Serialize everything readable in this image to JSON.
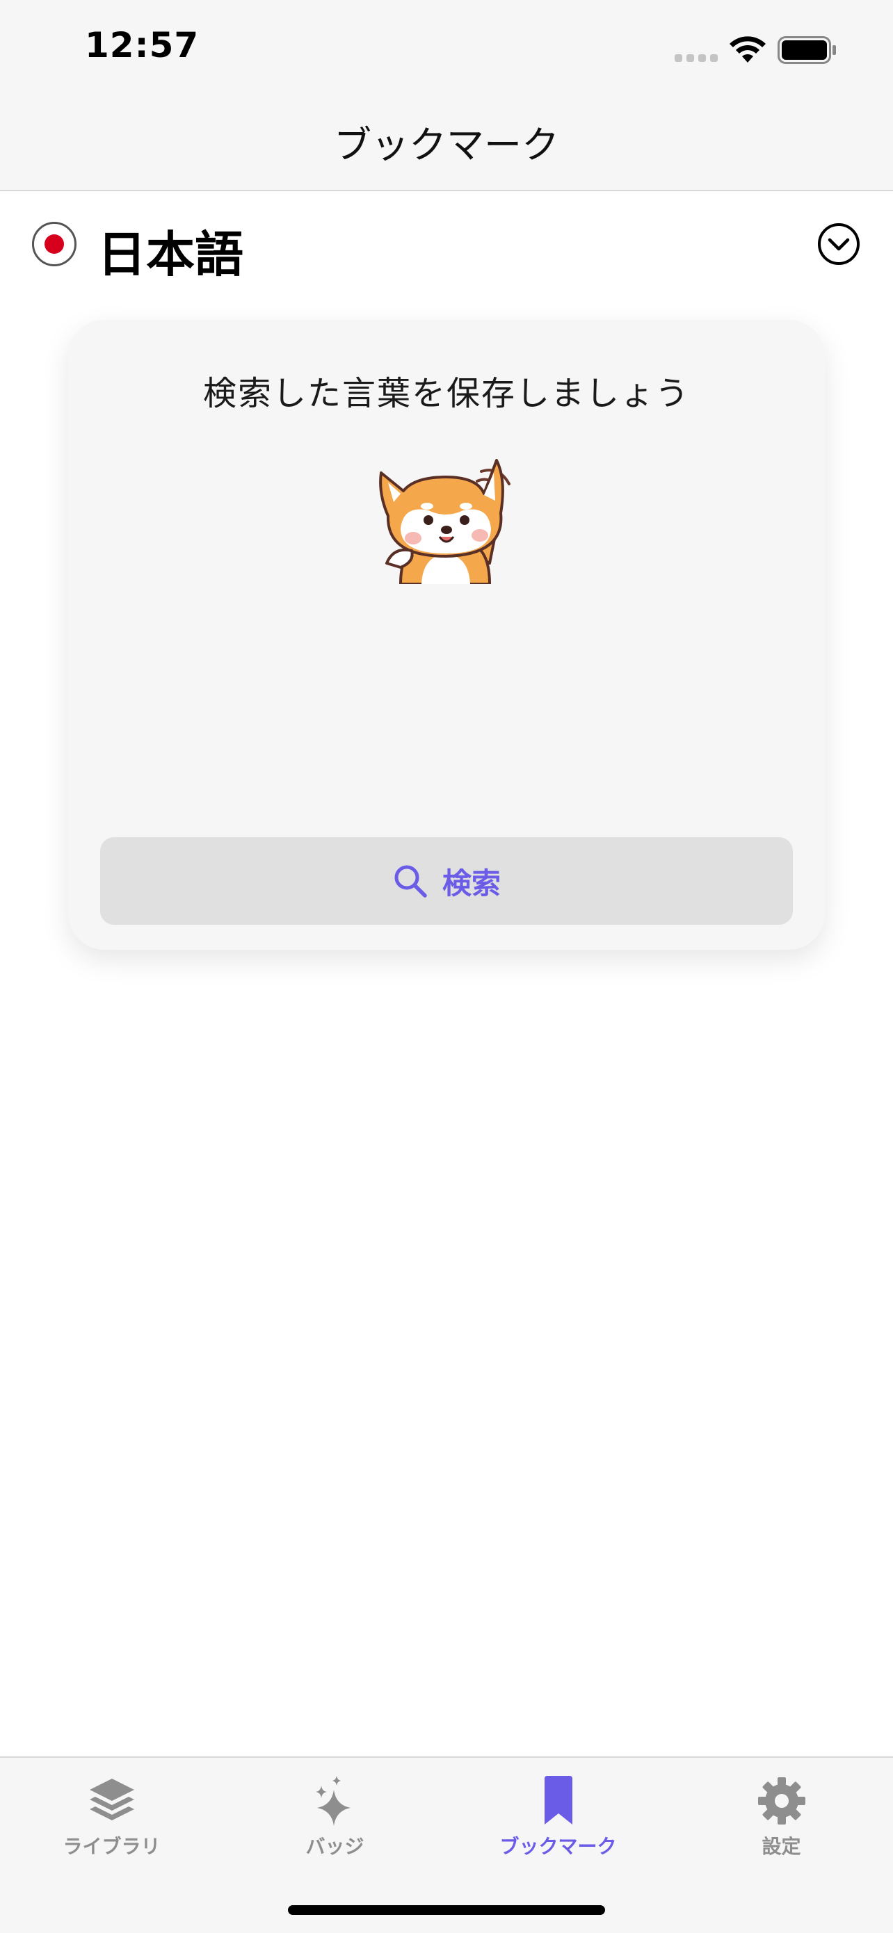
{
  "status_bar": {
    "time": "12:57",
    "icons": [
      "cellular-signal-icon",
      "wifi-icon",
      "battery-icon"
    ]
  },
  "nav_bar": {
    "title": "ブックマーク"
  },
  "language": {
    "name": "日本語",
    "flag_icon": "japan-flag-icon",
    "toggle_icon": "chevron-down-circle-icon"
  },
  "empty_state": {
    "message": "検索した言葉を保存しましょう",
    "illustration": "shiba-dog-waving-illustration",
    "search_button_label": "検索",
    "search_icon": "search-icon"
  },
  "tab_bar": {
    "tabs": [
      {
        "label": "ライブラリ",
        "icon": "stack-layers-icon",
        "active": false
      },
      {
        "label": "バッジ",
        "icon": "sparkles-icon",
        "active": false
      },
      {
        "label": "ブックマーク",
        "icon": "bookmark-icon",
        "active": true
      },
      {
        "label": "設定",
        "icon": "gear-icon",
        "active": false
      }
    ]
  },
  "colors": {
    "accent": "#6b5ce7",
    "inactive": "#8e8e8e",
    "bar_background": "#f6f6f6",
    "flag_red": "#d6001c"
  }
}
